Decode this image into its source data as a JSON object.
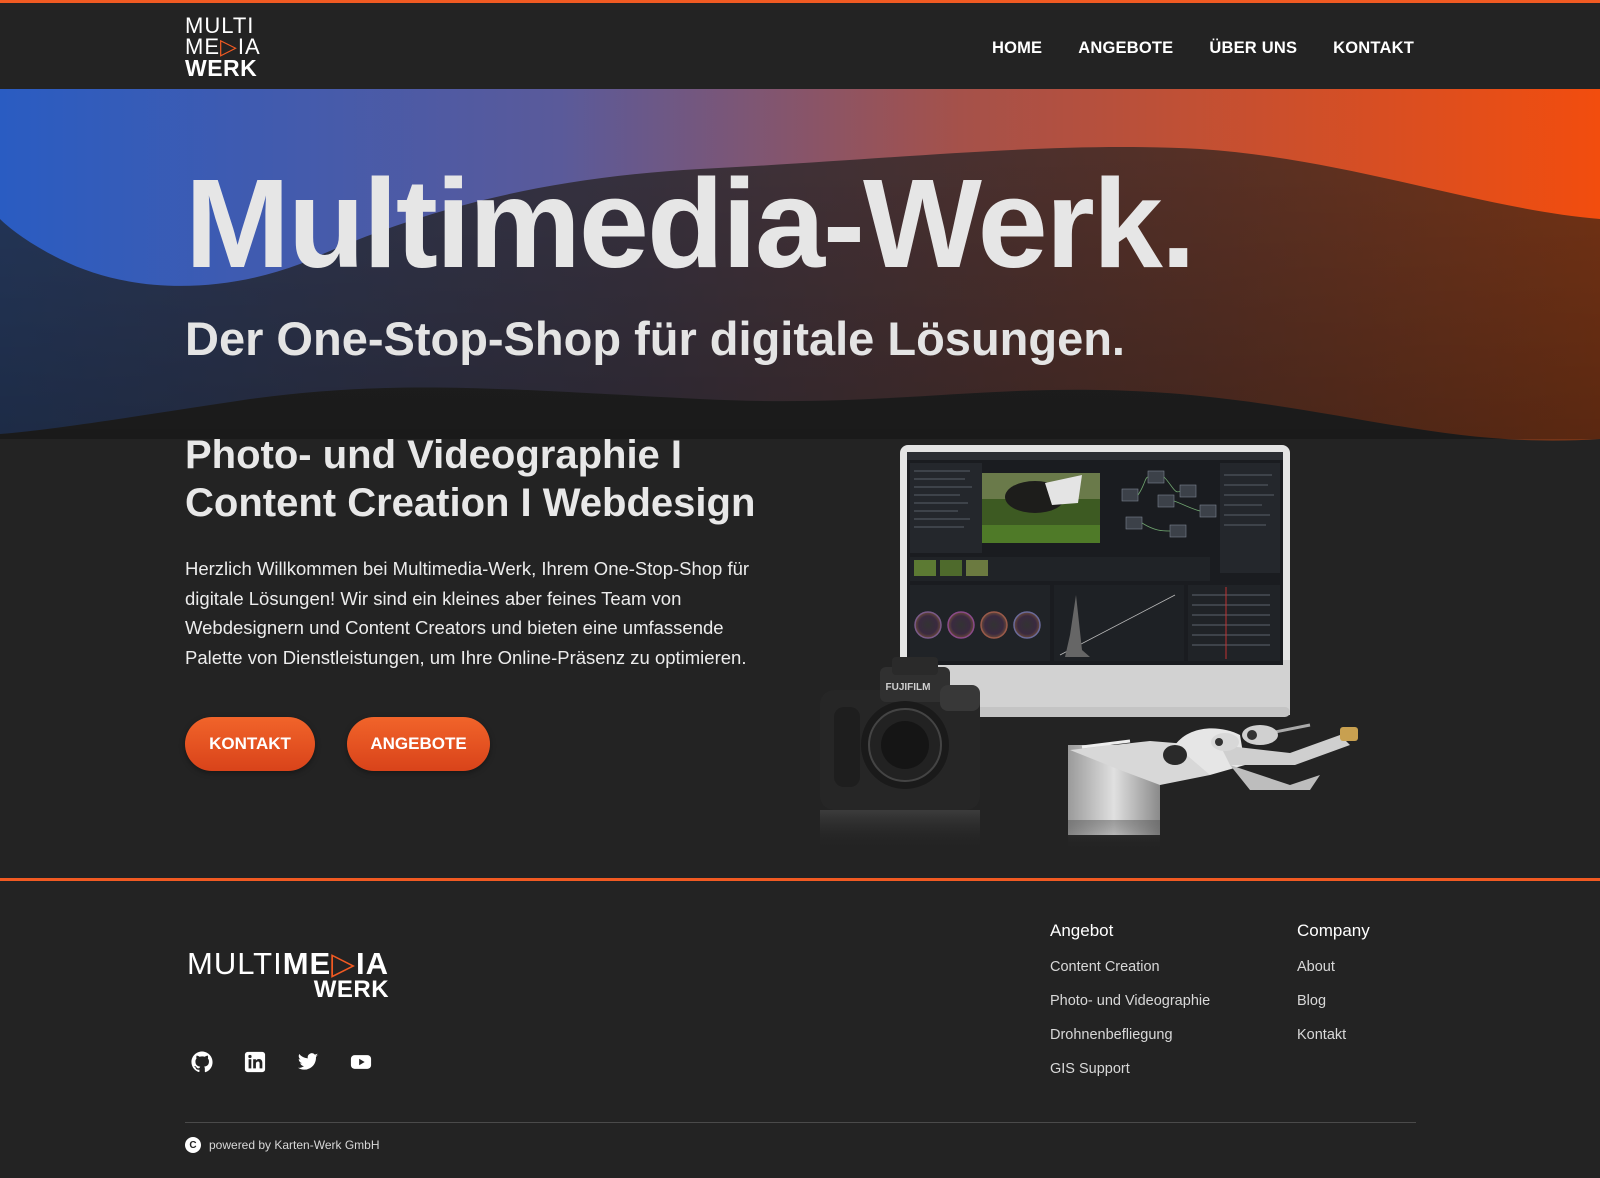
{
  "logo": {
    "line1": "MULTI",
    "line2_a": "ME",
    "line2_play": "▷",
    "line2_b": "IA",
    "line3": "WERK"
  },
  "nav": [
    "HOME",
    "ANGEBOTE",
    "ÜBER UNS",
    "KONTAKT"
  ],
  "hero": {
    "title": "Multimedia-Werk.",
    "subtitle": "Der One-Stop-Shop für digitale Lösungen."
  },
  "services": {
    "line1": "Photo- und Videographie I",
    "line2": "Content Creation I Webdesign"
  },
  "intro": "Herzlich Willkommen bei Multimedia-Werk, Ihrem One-Stop-Shop für digitale Lösungen! Wir sind ein kleines aber feines Team von Webdesignern und Content Creators und bieten eine umfassende Palette von Dienstleistungen, um Ihre Online-Präsenz zu optimieren.",
  "buttons": {
    "kontakt": "KONTAKT",
    "angebote": "ANGEBOTE"
  },
  "product_labels": {
    "camera_brand": "FUJIFILM"
  },
  "footer": {
    "logo": {
      "multi": "MULTI",
      "me": "ME",
      "play": "▷",
      "ia": "IA",
      "werk": "WERK"
    },
    "socials": [
      "github-icon",
      "linkedin-icon",
      "twitter-icon",
      "youtube-icon"
    ],
    "col_angebot": {
      "title": "Angebot",
      "links": [
        "Content Creation",
        "Photo- und Videographie",
        "Drohnenbefliegung",
        "GIS Support"
      ]
    },
    "col_company": {
      "title": "Company",
      "links": [
        "About",
        "Blog",
        "Kontakt"
      ]
    },
    "copyright_symbol": "C",
    "copyright": "powered by Karten-Werk GmbH"
  },
  "colors": {
    "accent": "#f15a22",
    "blue": "#2e5fbf",
    "background": "#232323"
  }
}
